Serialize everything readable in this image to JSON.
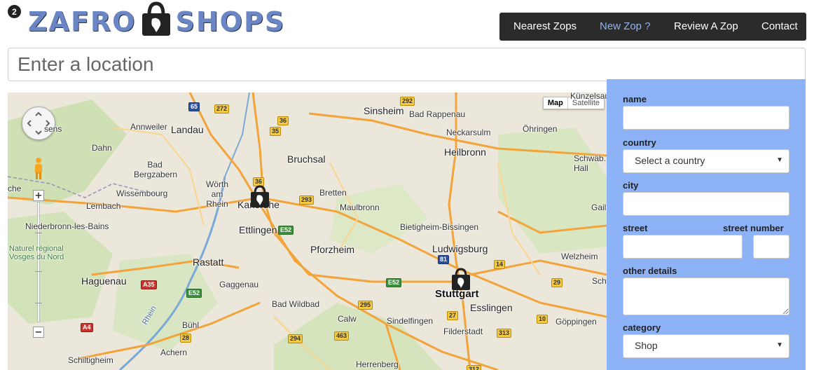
{
  "header": {
    "badge": "2",
    "logo_left": "ZAFRO",
    "logo_right": "SHOPS"
  },
  "nav": {
    "items": [
      {
        "label": "Nearest Zops"
      },
      {
        "label": "New Zop ?"
      },
      {
        "label": "Review A Zop"
      },
      {
        "label": "Contact"
      }
    ],
    "active_color": "#8fb3f3",
    "background": "#2b2b2b"
  },
  "search": {
    "placeholder": "Enter a location"
  },
  "map": {
    "type_buttons": [
      "Map",
      "Satellite"
    ],
    "zoom_in": "+",
    "zoom_out": "−",
    "labels": {
      "kunzelsau": "Künzelsau",
      "sinsheim": "Sinsheim",
      "bad_rappenau": "Bad Rappenau",
      "neckarsulm": "Neckarsulm",
      "ohringen": "Öhringen",
      "heilbronn": "Heilbronn",
      "schwab_hall": "Schwäb. Hall",
      "annweiler": "Annweiler",
      "landau": "Landau",
      "dahn": "Dahn",
      "bad_bergzabern": "Bad Bergzabern",
      "bruchsal": "Bruchsal",
      "worth": "Wörth am Rhein",
      "karlsruhe": "Karlsruhe",
      "bretten": "Bretten",
      "maulbronn": "Maulbronn",
      "wissembourg": "Wissembourg",
      "lembach": "Lembach",
      "niederbronn": "Niederbronn-les-Bains",
      "naturel": "Naturel régional Vosges du Nord",
      "ettlingen": "Ettlingen",
      "bietigheim": "Bietigheim-Bissingen",
      "pforzheim": "Pforzheim",
      "ludwigsburg": "Ludwigsburg",
      "welzheim": "Welzheim",
      "rastatt": "Rastatt",
      "haguenau": "Haguenau",
      "gaggenau": "Gaggenau",
      "stuttgart": "Stuttgart",
      "esslingen": "Esslingen",
      "bad_wildbad": "Bad Wildbad",
      "calw": "Calw",
      "sindelfingen": "Sindelfingen",
      "filderstadt": "Filderstadt",
      "goppingen": "Göppingen",
      "buhl": "Bühl",
      "achern": "Achern",
      "schiltigheim": "Schiltigheim",
      "herrenberg": "Herrenberg",
      "sens": "sens",
      "che": "che",
      "gaile": "Gaile",
      "sch": "Sch",
      "rhein": "Rhein"
    },
    "shields": {
      "s65": "65",
      "s272": "272",
      "s36a": "36",
      "s35": "35",
      "s292": "292",
      "s36b": "36",
      "s293": "293",
      "s52a": "E52",
      "s81": "81",
      "s14": "14",
      "s29": "29",
      "s52b": "E52",
      "s35b": "A35",
      "s52c": "E52",
      "s295": "295",
      "s27": "27",
      "s10": "10",
      "s4": "A4",
      "s294": "294",
      "s463": "463",
      "s313": "313",
      "s28": "28",
      "s312": "312"
    }
  },
  "form": {
    "name_label": "name",
    "country_label": "country",
    "country_value": "Select a country",
    "city_label": "city",
    "street_label": "street",
    "street_number_label": "street number",
    "other_details_label": "other details",
    "category_label": "category",
    "category_value": "Shop",
    "background": "#8db3f6"
  }
}
